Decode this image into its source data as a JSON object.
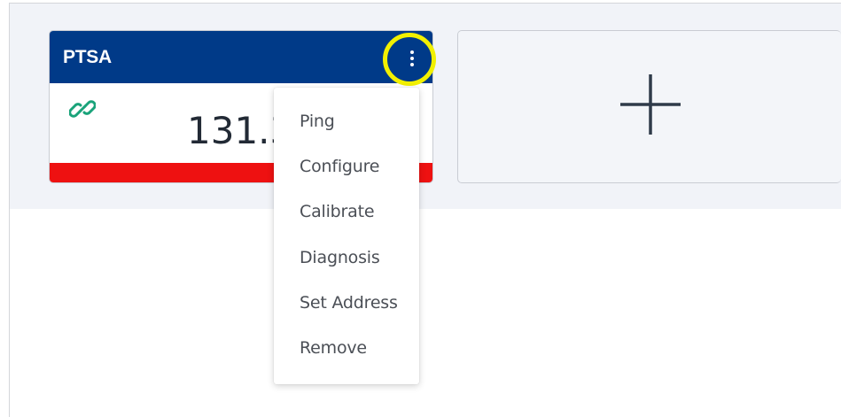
{
  "device_card": {
    "title": "PTSA",
    "value": "131.3",
    "status_color": "#ee1111",
    "header_color": "#003a88",
    "icon": "link-icon"
  },
  "add_card": {
    "icon": "plus-icon"
  },
  "menu_button": {
    "icon": "kebab-menu-icon",
    "highlight_color": "#f2f000"
  },
  "context_menu": {
    "items": [
      {
        "label": "Ping"
      },
      {
        "label": "Configure"
      },
      {
        "label": "Calibrate"
      },
      {
        "label": "Diagnosis"
      },
      {
        "label": "Set Address"
      },
      {
        "label": "Remove"
      }
    ]
  }
}
